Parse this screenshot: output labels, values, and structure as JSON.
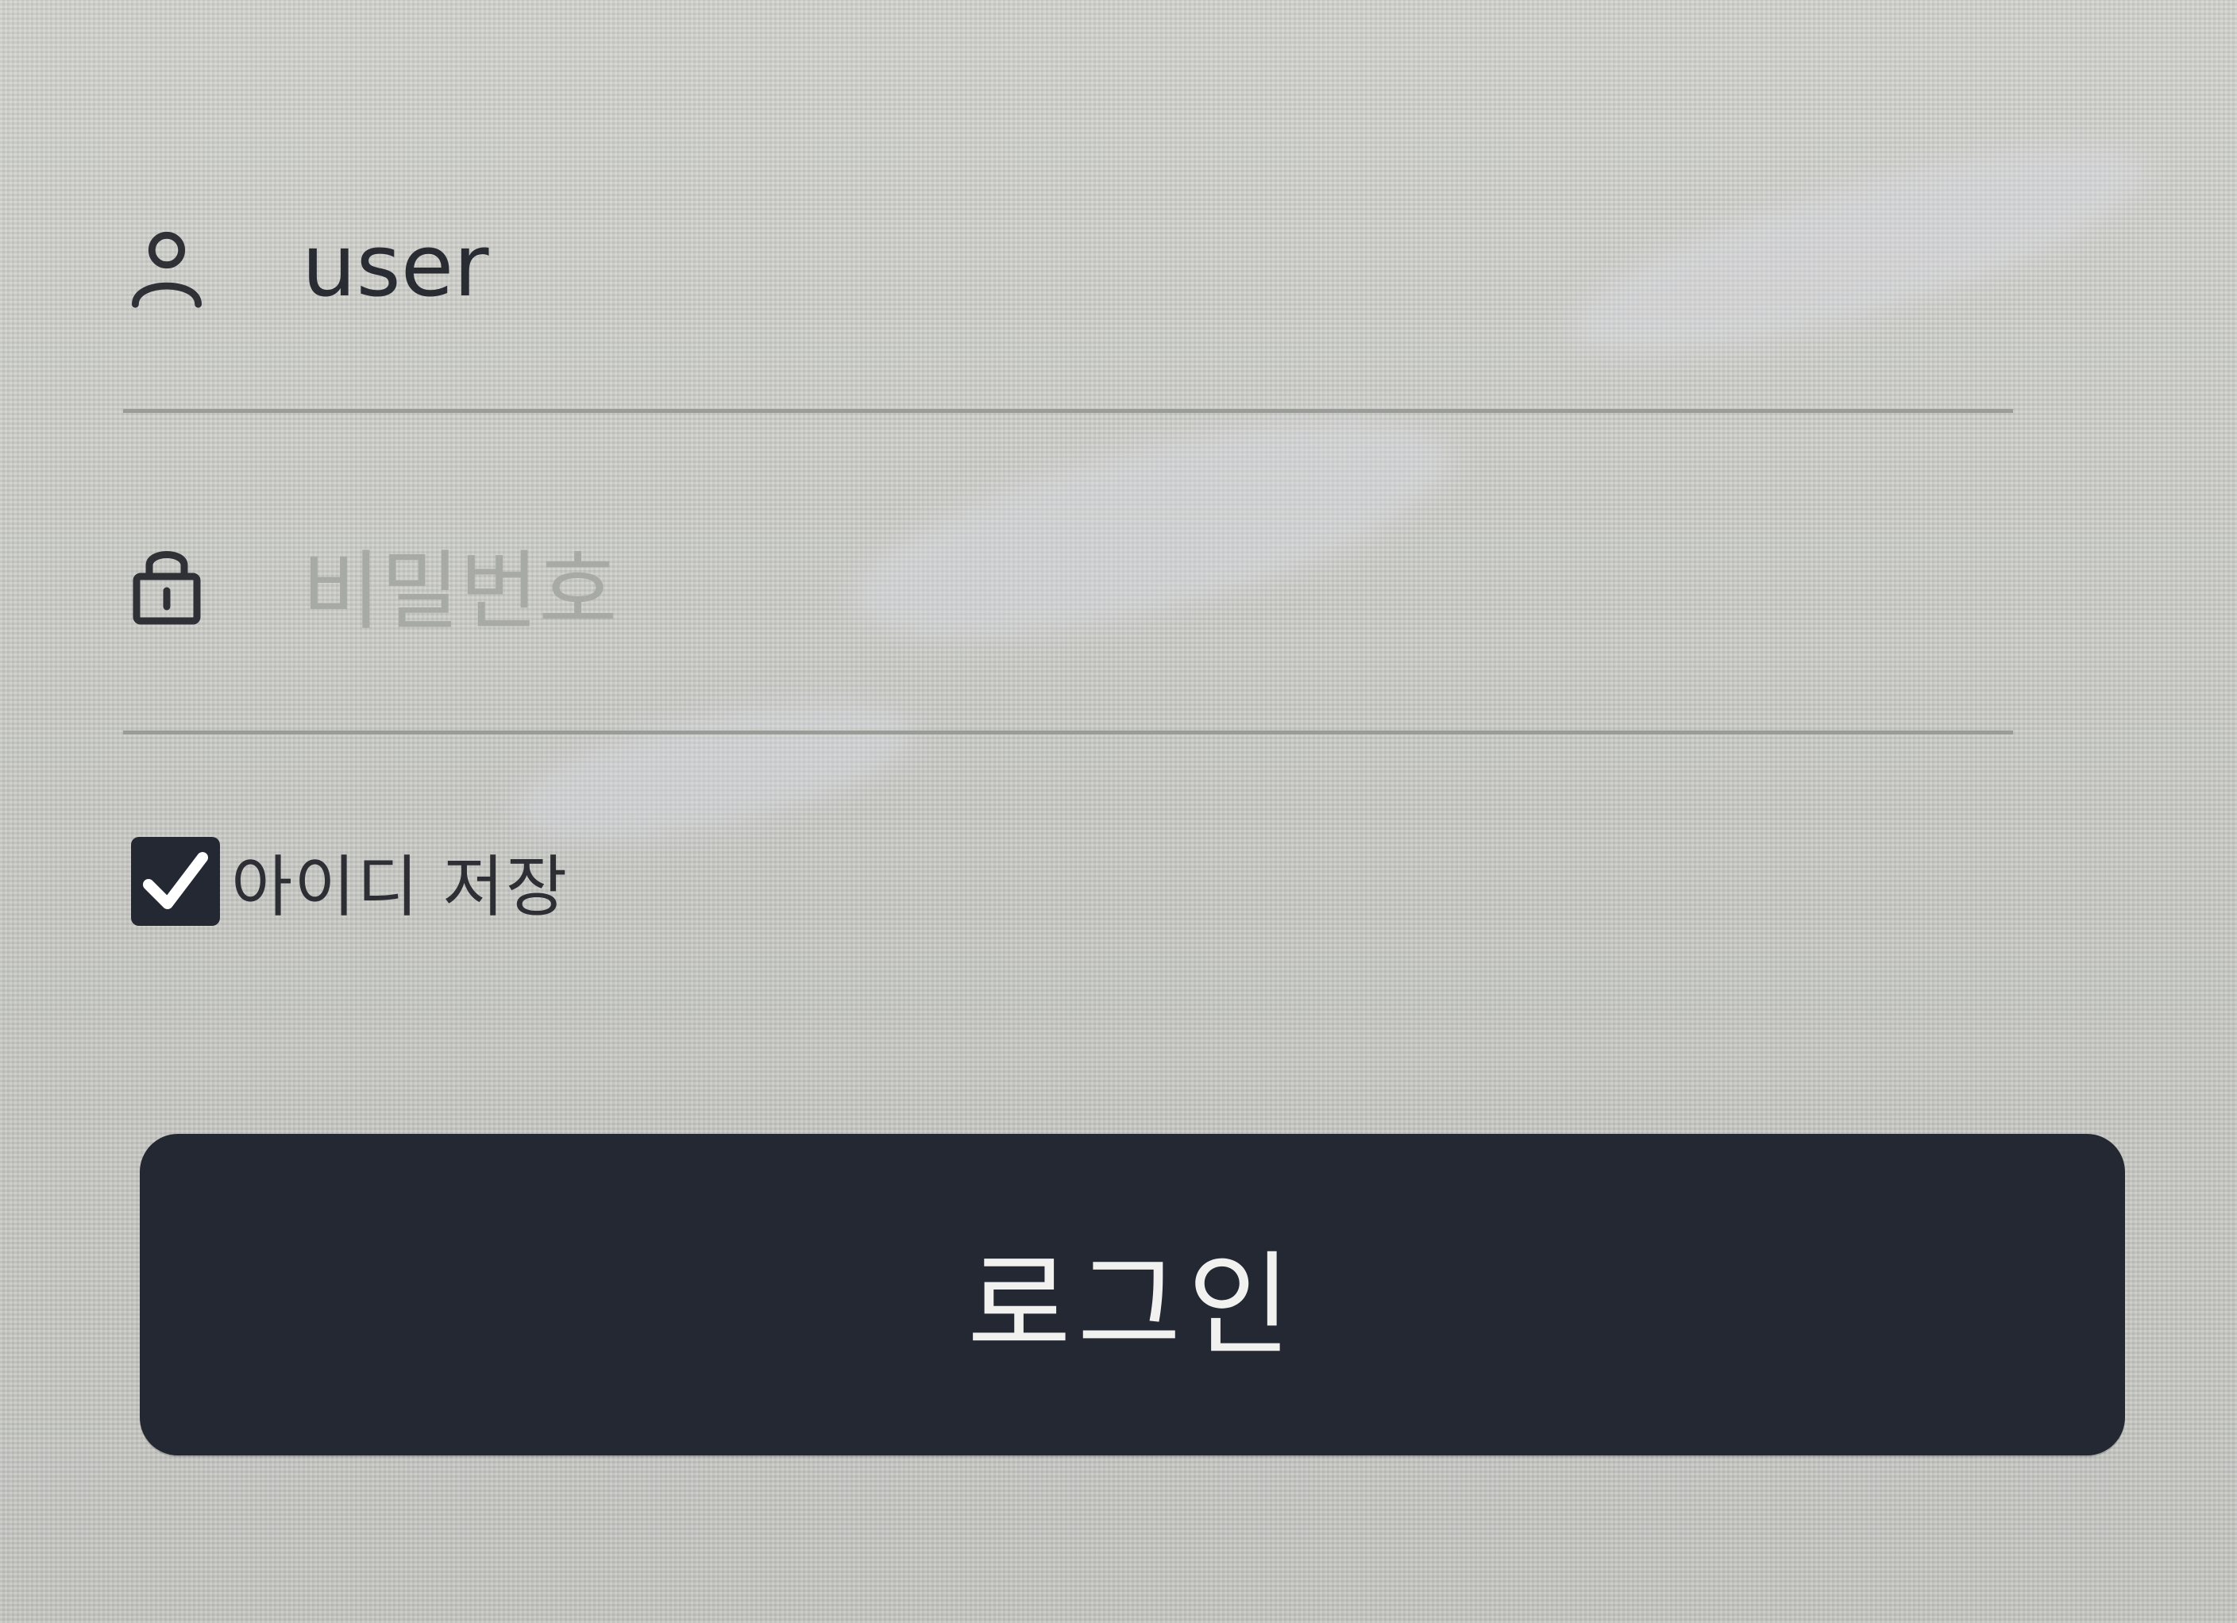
{
  "login_form": {
    "username": {
      "icon": "user-icon",
      "value": "user",
      "placeholder": ""
    },
    "password": {
      "icon": "lock-icon",
      "value": "",
      "placeholder": "비밀번호"
    },
    "remember_id": {
      "label": "아이디 저장",
      "checked": true
    },
    "submit_label": "로그인"
  },
  "colors": {
    "button_background": "#242833",
    "button_text": "#f1f2f0",
    "checkbox_fill": "#232833",
    "underline": "#9a9c98",
    "placeholder_text": "#a8aaa6",
    "input_text": "#2a2c33"
  }
}
